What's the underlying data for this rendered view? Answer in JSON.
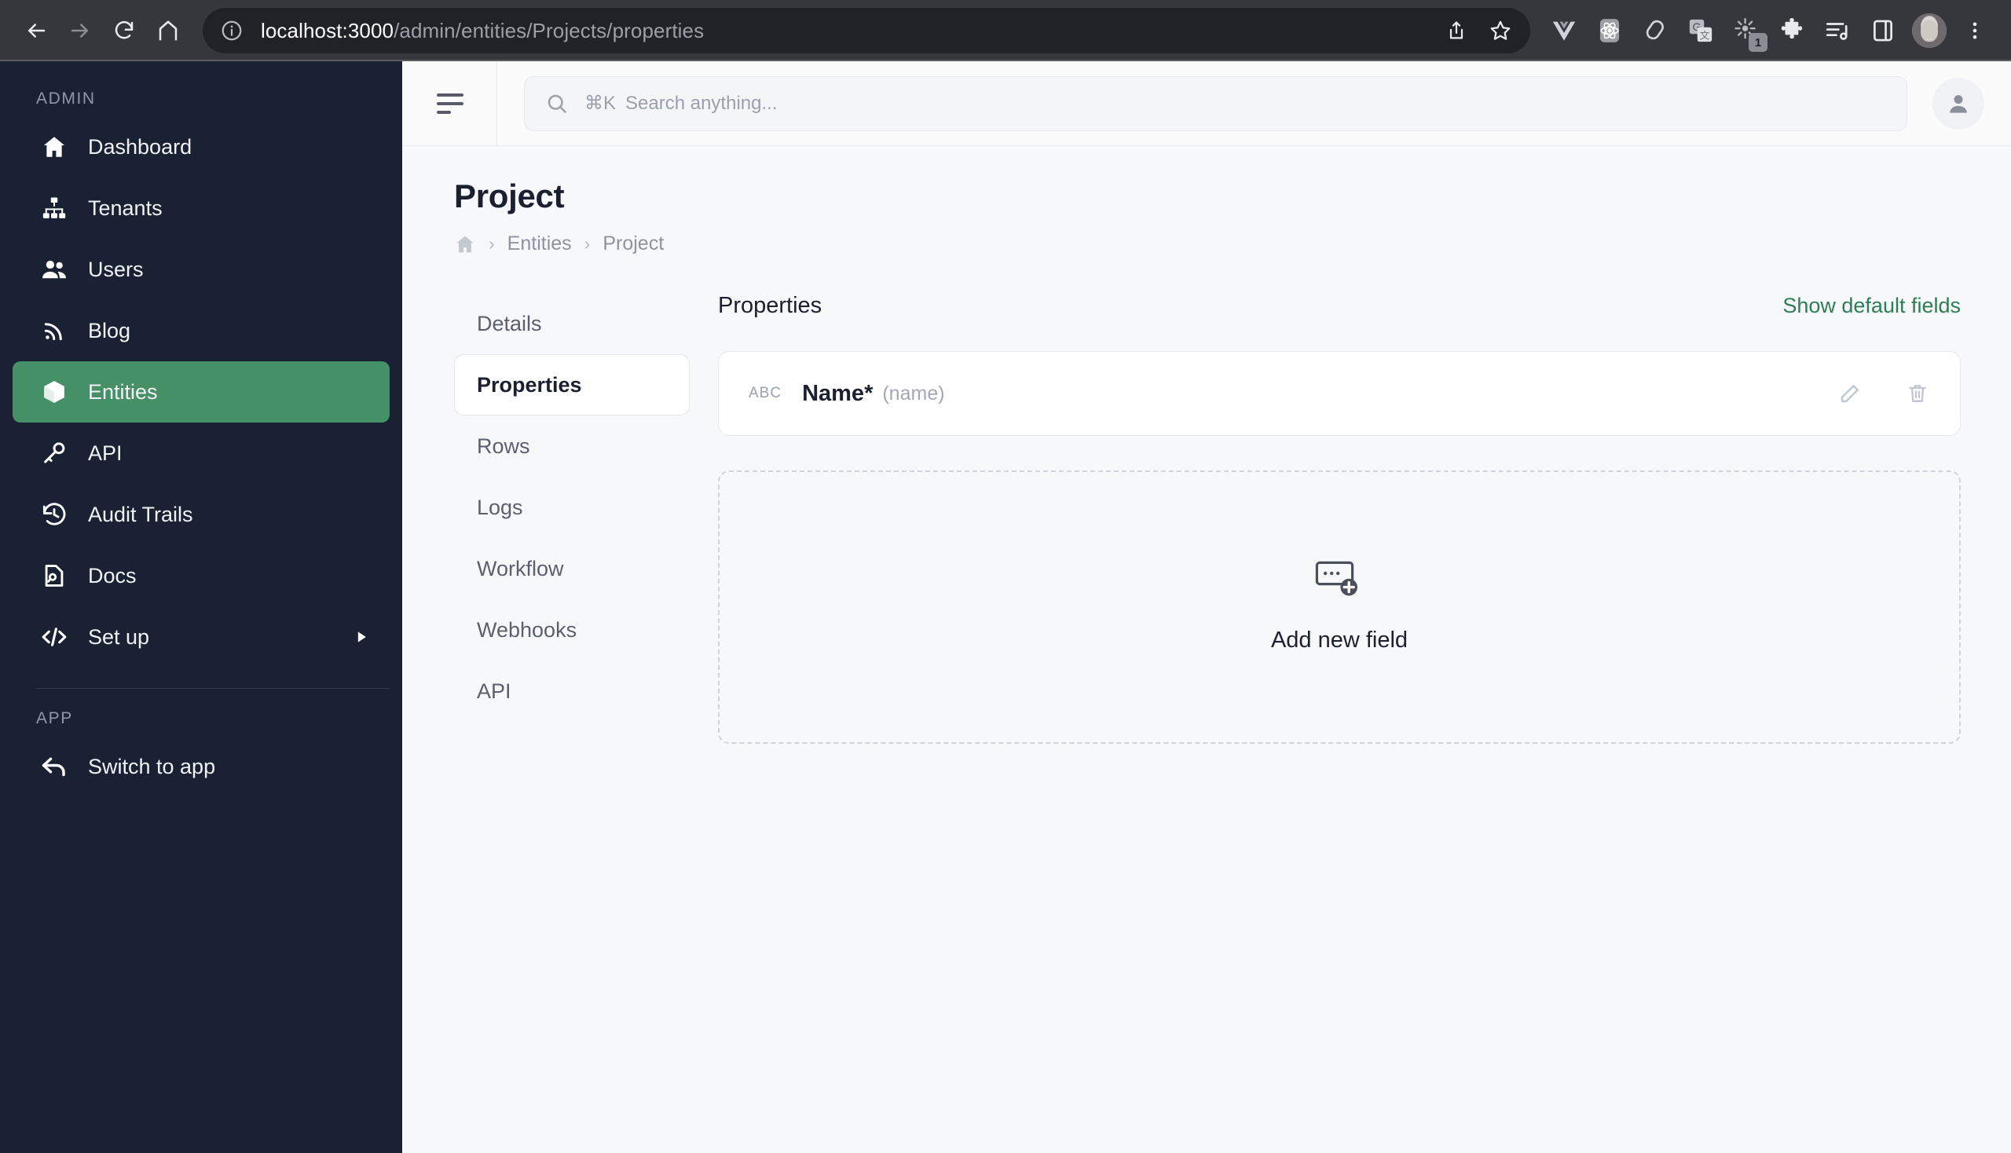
{
  "browser": {
    "back_label": "Back",
    "forward_label": "Forward",
    "reload_label": "Reload",
    "home_label": "Home",
    "url_host": "localhost:3000",
    "url_path": "/admin/entities/Projects/properties",
    "share_label": "Share",
    "bookmark_label": "Bookmark this tab",
    "extensions": [
      {
        "name": "vue-devtools-icon",
        "label": "Vue.js devtools",
        "badge": ""
      },
      {
        "name": "react-devtools-icon",
        "label": "React Developer Tools",
        "badge": ""
      },
      {
        "name": "svelte-devtools-icon",
        "label": "Svelte DevTools",
        "badge": ""
      },
      {
        "name": "google-translate-icon",
        "label": "Google Translate",
        "badge": ""
      },
      {
        "name": "starburst-extension-icon",
        "label": "Extension",
        "badge": "1"
      },
      {
        "name": "puzzle-piece-icon",
        "label": "Extensions",
        "badge": ""
      },
      {
        "name": "reading-list-icon",
        "label": "Reading list",
        "badge": ""
      },
      {
        "name": "side-panel-icon",
        "label": "Side panel",
        "badge": ""
      }
    ],
    "profile_label": "Profile",
    "menu_label": "Customize and control"
  },
  "sidebar": {
    "section_admin": "ADMIN",
    "section_app": "APP",
    "items": [
      {
        "id": "dashboard",
        "label": "Dashboard",
        "icon": "home-icon",
        "active": false,
        "caret": false
      },
      {
        "id": "tenants",
        "label": "Tenants",
        "icon": "org-chart-icon",
        "active": false,
        "caret": false
      },
      {
        "id": "users",
        "label": "Users",
        "icon": "users-icon",
        "active": false,
        "caret": false
      },
      {
        "id": "blog",
        "label": "Blog",
        "icon": "rss-icon",
        "active": false,
        "caret": false
      },
      {
        "id": "entities",
        "label": "Entities",
        "icon": "cube-icon",
        "active": true,
        "caret": false
      },
      {
        "id": "api",
        "label": "API",
        "icon": "key-icon",
        "active": false,
        "caret": false
      },
      {
        "id": "audit-trails",
        "label": "Audit Trails",
        "icon": "history-icon",
        "active": false,
        "caret": false
      },
      {
        "id": "docs",
        "label": "Docs",
        "icon": "document-search-icon",
        "active": false,
        "caret": false
      },
      {
        "id": "set-up",
        "label": "Set up",
        "icon": "code-icon",
        "active": false,
        "caret": true
      }
    ],
    "app_items": [
      {
        "id": "switch-to-app",
        "label": "Switch to app",
        "icon": "arrow-back-icon",
        "active": false,
        "caret": false
      }
    ]
  },
  "topbar": {
    "search_kbd": "⌘K",
    "search_placeholder": "Search anything...",
    "search_value": ""
  },
  "page": {
    "title": "Project",
    "breadcrumb": [
      {
        "label": "",
        "icon": "home-icon"
      },
      {
        "label": "Entities",
        "icon": ""
      },
      {
        "label": "Project",
        "icon": ""
      }
    ],
    "breadcrumb_separator": "›"
  },
  "tabs": [
    {
      "id": "details",
      "label": "Details",
      "active": false
    },
    {
      "id": "properties",
      "label": "Properties",
      "active": true
    },
    {
      "id": "rows",
      "label": "Rows",
      "active": false
    },
    {
      "id": "logs",
      "label": "Logs",
      "active": false
    },
    {
      "id": "workflow",
      "label": "Workflow",
      "active": false
    },
    {
      "id": "webhooks",
      "label": "Webhooks",
      "active": false
    },
    {
      "id": "api",
      "label": "API",
      "active": false
    }
  ],
  "panel": {
    "title": "Properties",
    "show_defaults_label": "Show default fields",
    "properties": [
      {
        "type_label": "ABC",
        "name": "Name*",
        "key": "(name)",
        "edit_label": "Edit",
        "delete_label": "Delete"
      }
    ],
    "add_field_label": "Add new field"
  },
  "colors": {
    "accent_green": "#469068",
    "link_green": "#2E7D54",
    "sidebar_bg": "#1A2133",
    "content_bg": "#F7F8FA",
    "chrome_bg": "#35373C"
  }
}
